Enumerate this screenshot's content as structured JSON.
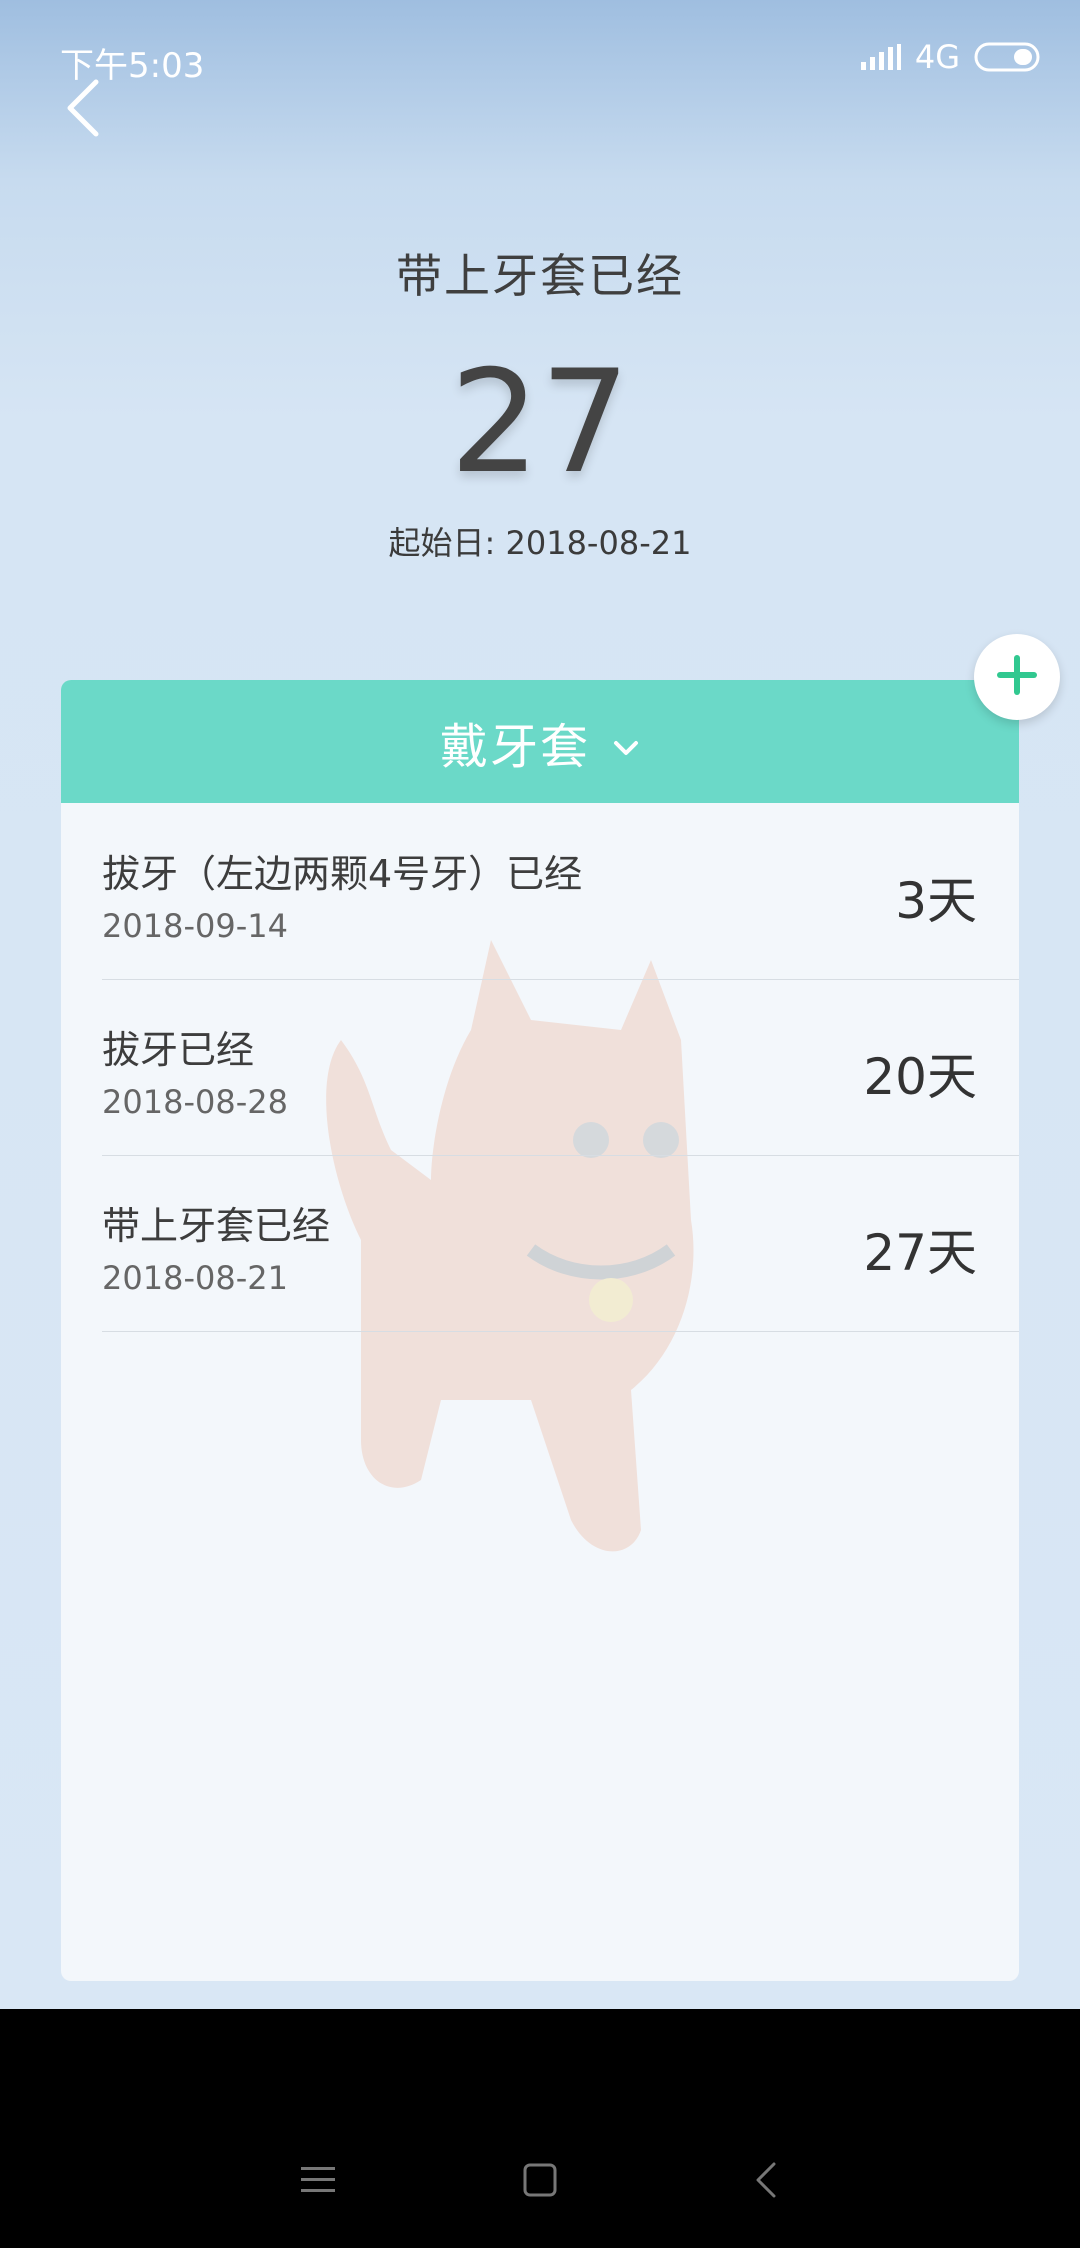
{
  "status": {
    "time": "下午5:03",
    "network": "4G"
  },
  "header": {
    "title": "带上牙套已经",
    "count": "27",
    "start_label": "起始日: 2018-08-21"
  },
  "card": {
    "category": "戴牙套",
    "items": [
      {
        "title": "拔牙（左边两颗4号牙）已经",
        "date": "2018-09-14",
        "days": "3天"
      },
      {
        "title": "拔牙已经",
        "date": "2018-08-28",
        "days": "20天"
      },
      {
        "title": "带上牙套已经",
        "date": "2018-08-21",
        "days": "27天"
      }
    ]
  },
  "colors": {
    "accent": "#6bd9c8",
    "add_icon": "#31c890"
  },
  "icons": {
    "back": "back-arrow-icon",
    "add": "plus-icon",
    "dropdown": "chevron-down-icon",
    "nav_menu": "menu-icon",
    "nav_home": "home-icon",
    "nav_back": "back-icon"
  }
}
